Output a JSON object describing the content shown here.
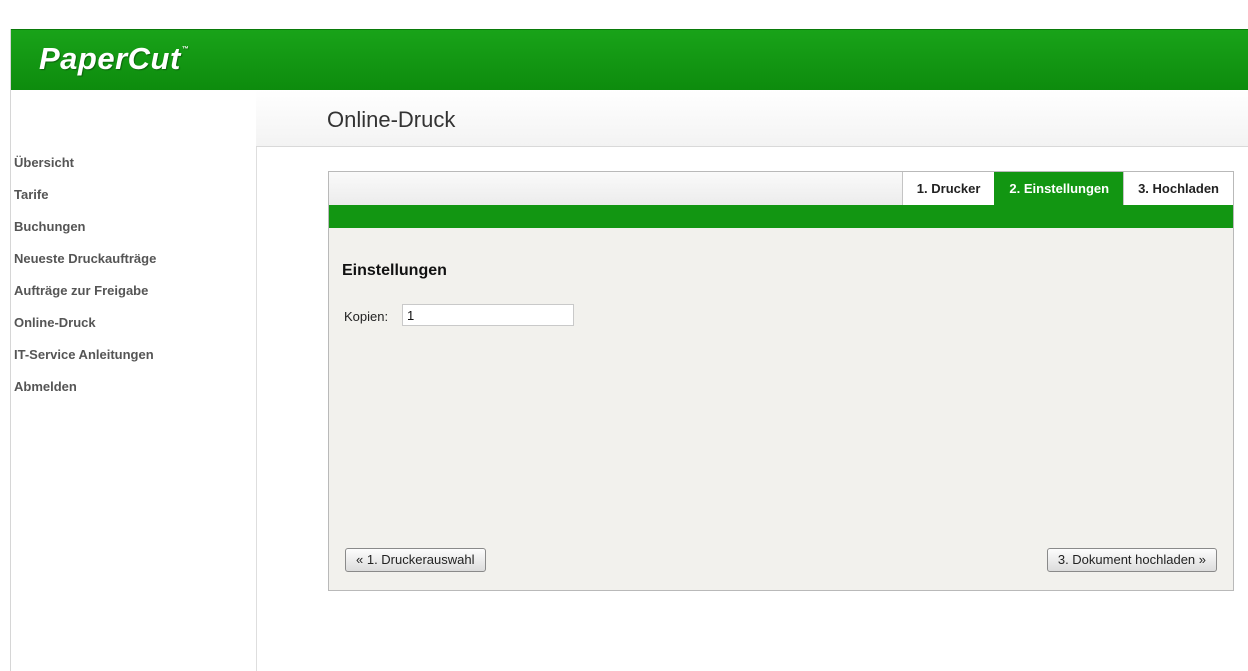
{
  "brand": {
    "logo_text": "PaperCut",
    "trademark": "™"
  },
  "page": {
    "title": "Online-Druck"
  },
  "sidebar": {
    "items": [
      {
        "label": "Übersicht"
      },
      {
        "label": "Tarife"
      },
      {
        "label": "Buchungen"
      },
      {
        "label": "Neueste Druckaufträge"
      },
      {
        "label": "Aufträge zur Freigabe"
      },
      {
        "label": "Online-Druck"
      },
      {
        "label": "IT-Service Anleitungen"
      },
      {
        "label": "Abmelden"
      }
    ]
  },
  "wizard": {
    "tabs": [
      {
        "label": "1. Drucker",
        "active": false
      },
      {
        "label": "2. Einstellungen",
        "active": true
      },
      {
        "label": "3. Hochladen",
        "active": false
      }
    ],
    "section_heading": "Einstellungen",
    "copies": {
      "label": "Kopien:",
      "value": "1"
    },
    "prev_button": "« 1. Druckerauswahl",
    "next_button": "3. Dokument hochladen »"
  },
  "colors": {
    "brand_green": "#129612",
    "header_green": "#19a319"
  }
}
